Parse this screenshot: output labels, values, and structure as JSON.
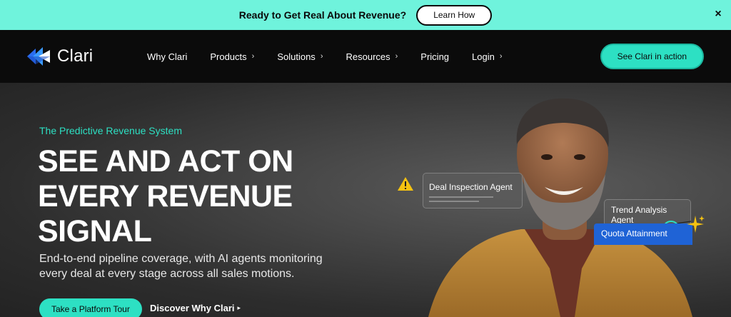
{
  "announcement": {
    "text": "Ready to Get Real About Revenue?",
    "button": "Learn How",
    "close": "×"
  },
  "nav": {
    "logo_text": "Clari",
    "items": [
      {
        "label": "Why Clari",
        "chevron": false
      },
      {
        "label": "Products",
        "chevron": true
      },
      {
        "label": "Solutions",
        "chevron": true
      },
      {
        "label": "Resources",
        "chevron": true
      },
      {
        "label": "Pricing",
        "chevron": false
      },
      {
        "label": "Login",
        "chevron": true
      }
    ],
    "cta": "See Clari in action"
  },
  "hero": {
    "eyebrow": "The Predictive Revenue System",
    "headline_lines": [
      "SEE AND ACT ON",
      "EVERY REVENUE",
      "SIGNAL"
    ],
    "subtext": "End-to-end pipeline coverage, with AI agents monitoring every deal at every stage across all sales motions.",
    "primary_button": "Take a Platform Tour",
    "secondary_link": "Discover Why Clari"
  },
  "cards": {
    "trend": "Trend Analysis Agent",
    "deal": "Deal Inspection Agent",
    "quota": "Quota Attainment"
  },
  "colors": {
    "accent": "#2de0c3",
    "announce_bg": "#6ff3dc",
    "nav_bg": "#0b0b0b",
    "quota_blue": "#1f63d6",
    "warning_yellow": "#f5c211"
  },
  "icons": {
    "chevron": "›",
    "triangle": "▸"
  }
}
